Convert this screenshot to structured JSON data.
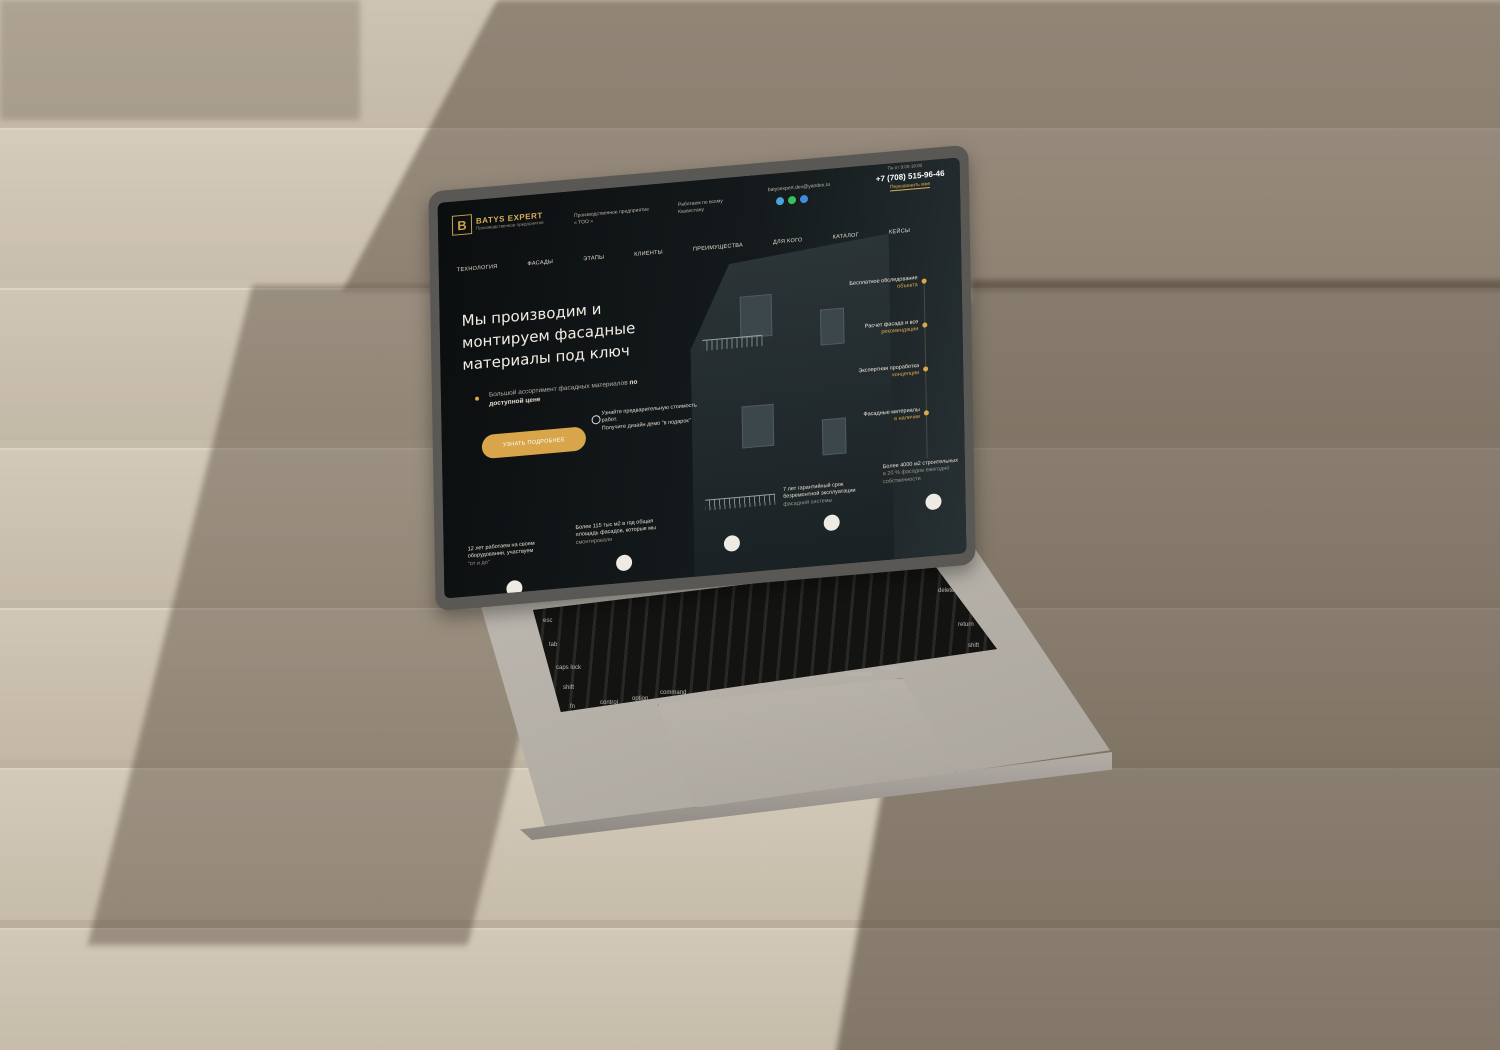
{
  "site": {
    "logo": {
      "name": "BATYS EXPERT",
      "tagline": "Производственное предприятие"
    },
    "header": {
      "company_type": "Производственное предприятие",
      "company_name": "« ТОО »",
      "work_area_label": "Работаем по всему",
      "work_area_value": "Казахстану",
      "email": "batysexpert.dev@yandex.ru",
      "hours": "Пн-пт 9:00-18:00",
      "phone": "+7 (708) 515-96-46",
      "callback": "Перезвонить мне"
    },
    "nav": [
      "ТЕХНОЛОГИЯ",
      "ФАСАДЫ",
      "ЭТАПЫ",
      "КЛИЕНТЫ",
      "ПРЕИМУЩЕСТВА",
      "ДЛЯ КОГО",
      "КАТАЛОГ",
      "КЕЙСЫ"
    ],
    "hero": {
      "title": "Мы производим и монтируем фасадные материалы под ключ",
      "subtitle_plain": "Большой ассортимент фасадных материалов",
      "subtitle_bold": "по доступной цене",
      "cta": "УЗНАТЬ ПОДРОБНЕЕ",
      "whatsapp_title": "Узнайте предварительную стоимость работ.",
      "whatsapp_text": "Получите дизайн демо \"в подарок\""
    },
    "features": [
      {
        "title": "Бесплатное обследование",
        "sub": "объекта"
      },
      {
        "title": "Расчет фасада и все",
        "sub": "рекомендации"
      },
      {
        "title": "Экспертная проработка",
        "sub": "концепции"
      },
      {
        "title": "Фасадные материалы",
        "sub": "в наличии"
      }
    ],
    "stats": [
      {
        "main": "12 лет работаем на своем оборудовании, участвуем",
        "sub": "\"от и до\""
      },
      {
        "main": "Более 115 тыс м2 в год общая площадь фасадов, которые мы",
        "sub": "смонтировали"
      },
      {
        "main": "7 лет гарантийный срок безремонтной эксплуатации",
        "sub": "фасадной системы"
      },
      {
        "main": "Более 4000 м2 строительных",
        "sub": "в 20 % фасадов ежегодно собственности"
      }
    ]
  },
  "keyboard": {
    "row1_left": "esc",
    "row2_left": "tab",
    "row3_left": "caps lock",
    "row4_left": "shift",
    "row5_left": "fn",
    "row5_mods": [
      "control",
      "option",
      "command"
    ],
    "right_keys": [
      "delete",
      "return",
      "shift",
      "option",
      "command"
    ]
  },
  "colors": {
    "accent": "#d9a54a",
    "screen_bg": "#0c0f10",
    "laptop": "#b7b2aa"
  }
}
